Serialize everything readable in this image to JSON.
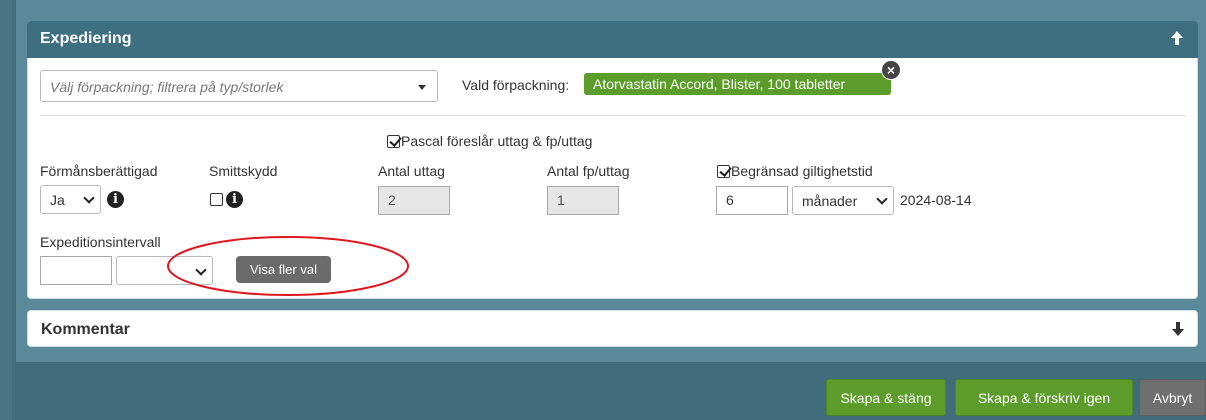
{
  "expediering": {
    "title": "Expediering",
    "package_placeholder": "Välj förpackning; filtrera på typ/storlek",
    "vald_label": "Vald förpackning:",
    "package_name": "Atorvastatin Accord",
    "package_detail": ", Blister, 100 tabletter",
    "remove_symbol": "×"
  },
  "form": {
    "pascal_label": "Pascal föreslår uttag & fp/uttag",
    "pascal_checked": true,
    "formans_label": "Förmånsberättigad",
    "formans_value": "Ja",
    "smittskydd_label": "Smittskydd",
    "smittskydd_checked": false,
    "antal_uttag_label": "Antal uttag",
    "antal_uttag_value": "2",
    "antal_fp_label": "Antal fp/uttag",
    "antal_fp_value": "1",
    "begransad_label": "Begränsad giltighetstid",
    "begransad_checked": true,
    "giltighet_value": "6",
    "giltighet_unit": "månader",
    "giltighet_date": "2024-08-14",
    "intervall_label": "Expeditionsintervall",
    "intervall_value": "",
    "intervall_unit": "",
    "visa_fler_label": "Visa fler val"
  },
  "kommentar": {
    "title": "Kommentar"
  },
  "footer": {
    "skapa_stang": "Skapa & stäng",
    "skapa_forskriv": "Skapa & förskriv igen",
    "avbryt": "Avbryt"
  },
  "colors": {
    "header_bg": "#3e6f80",
    "accent_green": "#5c9c2a",
    "annotation_red": "#e0161e"
  }
}
